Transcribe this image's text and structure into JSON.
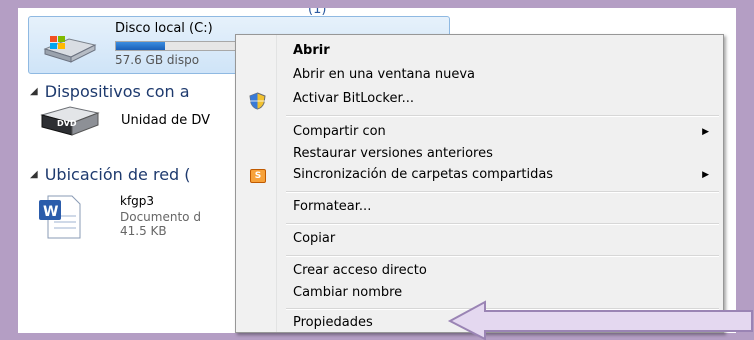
{
  "explorer": {
    "top_cut_text": "(1)",
    "drive": {
      "name": "Disco local (C:)",
      "free_text": "57.6 GB dispo",
      "usage_fraction": 0.35
    },
    "groups": [
      {
        "label": "Dispositivos con a"
      },
      {
        "label": "Ubicación de red ("
      }
    ],
    "dvd": {
      "name": "Unidad de DV",
      "badge": "DVD"
    },
    "file": {
      "name": "kfgp3",
      "type": "Documento d",
      "size": "41.5 KB",
      "icon_letter": "W"
    }
  },
  "context_menu": {
    "items": [
      {
        "label": "Abrir"
      },
      {
        "label": "Abrir en una ventana nueva"
      },
      {
        "label": "Activar BitLocker...",
        "icon": "shield-icon"
      },
      {
        "label": "Compartir con",
        "submenu": true
      },
      {
        "label": "Restaurar versiones anteriores"
      },
      {
        "label": "Sincronización de carpetas compartidas",
        "submenu": true,
        "icon": "sync-icon"
      },
      {
        "label": "Formatear..."
      },
      {
        "label": "Copiar"
      },
      {
        "label": "Crear acceso directo"
      },
      {
        "label": "Cambiar nombre"
      },
      {
        "label": "Propiedades"
      }
    ],
    "submenu_glyph": "▶",
    "sync_badge": "S"
  },
  "colors": {
    "background": "#b49ec4",
    "arrow_fill": "#e4d8f0",
    "arrow_stroke": "#9a84b4"
  }
}
